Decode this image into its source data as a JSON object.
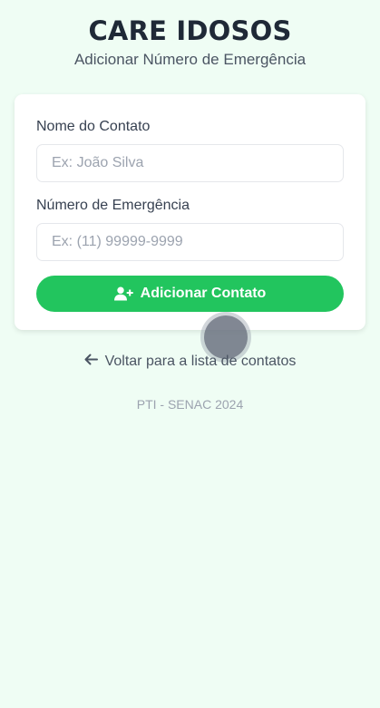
{
  "header": {
    "title": "CARE IDOSOS",
    "subtitle": "Adicionar Número de Emergência"
  },
  "form": {
    "name_label": "Nome do Contato",
    "name_value": "",
    "name_placeholder": "Ex: João Silva",
    "phone_label": "Número de Emergência",
    "phone_value": "",
    "phone_placeholder": "Ex: (11) 99999-9999",
    "submit_label": "Adicionar Contato",
    "submit_icon": "user-plus-icon"
  },
  "back_link": {
    "label": "Voltar para a lista de contatos",
    "icon": "arrow-left-icon"
  },
  "footer": {
    "text": "PTI - SENAC 2024"
  },
  "colors": {
    "background": "#effdf4",
    "primary": "#22c55e",
    "text": "#1f2937",
    "muted": "#9ca3af"
  }
}
